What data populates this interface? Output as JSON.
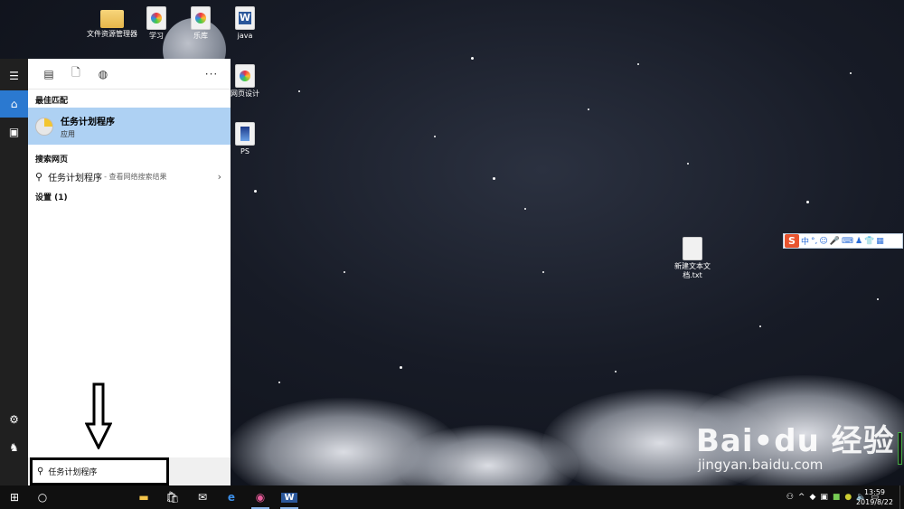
{
  "desktop": {
    "icons": [
      {
        "name": "desktop-icon-file-explorer",
        "label": "文件资源管理器",
        "kind": "folder"
      },
      {
        "name": "desktop-icon-study",
        "label": "学习",
        "kind": "color"
      },
      {
        "name": "desktop-icon-music",
        "label": "乐库",
        "kind": "color"
      },
      {
        "name": "desktop-icon-java",
        "label": "java",
        "kind": "word"
      },
      {
        "name": "desktop-icon-webdesign",
        "label": "网页设计",
        "kind": "color"
      },
      {
        "name": "desktop-icon-ps",
        "label": "PS",
        "kind": "ps"
      },
      {
        "name": "desktop-icon-newtext",
        "label": "新建文本文档.txt",
        "kind": "txt"
      }
    ]
  },
  "start": {
    "toolbar_more": "···",
    "best_match_title": "最佳匹配",
    "best_match": {
      "name": "任务计划程序",
      "type": "应用"
    },
    "web_title": "搜索网页",
    "web_result": {
      "query": "任务计划程序",
      "suffix": " - 查看网络搜索结果"
    },
    "settings_title": "设置 (1)",
    "search_value": "任务计划程序"
  },
  "ime": {
    "lang": "中"
  },
  "taskbar": {
    "clock_time": "13:59",
    "clock_date": "2019/8/22"
  },
  "watermark": {
    "logo": "Bai•du 经验",
    "url": "jingyan.baidu.com"
  },
  "colors": {
    "accent": "#2b79d0",
    "selection": "#aed1f3",
    "taskbar": "#101010"
  }
}
